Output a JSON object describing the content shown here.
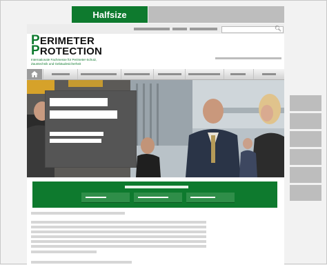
{
  "tabs": {
    "halfsize_label": "Halfsize"
  },
  "logo": {
    "line1_initial": "P",
    "line1_rest": "ERIMETER",
    "line2_initial": "P",
    "line2_rest": "ROTECTION",
    "tagline": "Internationale Fachmesse für Perimeter-Schutz, Zauntechnik und Gebäudesicherheit"
  },
  "icons": {
    "home": "home-icon",
    "search": "search-icon"
  },
  "colors": {
    "brand_green": "#0e7a2e",
    "placeholder_gray": "#bdbdbd"
  }
}
